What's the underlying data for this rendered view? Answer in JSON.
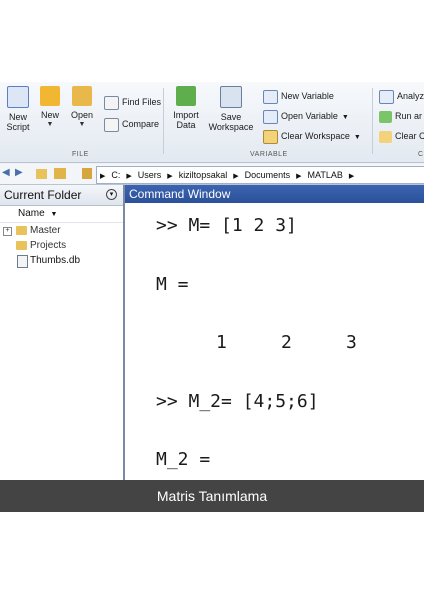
{
  "ribbon": {
    "file_buttons": [
      {
        "label1": "New",
        "label2": "Script",
        "icon": "new-script-icon",
        "color": "#5b7fc2"
      },
      {
        "label1": "New",
        "label2": "",
        "icon": "new-icon",
        "color": "#f2b732"
      },
      {
        "label1": "Open",
        "label2": "",
        "icon": "open-folder-icon",
        "color": "#e8b84a"
      }
    ],
    "find_files": "Find Files",
    "compare": "Compare",
    "file_group": "FILE",
    "import_data": {
      "label1": "Import",
      "label2": "Data"
    },
    "save_workspace": {
      "label1": "Save",
      "label2": "Workspace"
    },
    "new_variable": "New Variable",
    "open_variable": "Open Variable",
    "clear_workspace": "Clear Workspace",
    "variable_group": "VARIABLE",
    "analyze": "Analyz",
    "run_and": "Run ar",
    "clear_c": "Clear C",
    "code_group": "C"
  },
  "address": {
    "crumbs": [
      "C:",
      "Users",
      "kiziltopsakal",
      "Documents",
      "MATLAB"
    ]
  },
  "folder": {
    "title": "Current Folder",
    "name_header": "Name",
    "items": [
      {
        "name": "Master",
        "type": "folder"
      },
      {
        "name": "Projects",
        "type": "folder"
      },
      {
        "name": "Thumbs.db",
        "type": "file"
      }
    ]
  },
  "command": {
    "title": "Command Window",
    "lines": [
      ">> M= [1 2 3]",
      "M =",
      "1     2     3",
      ">> M_2= [4;5;6]",
      "M_2 ="
    ]
  },
  "caption": "Matris Tanımlama"
}
